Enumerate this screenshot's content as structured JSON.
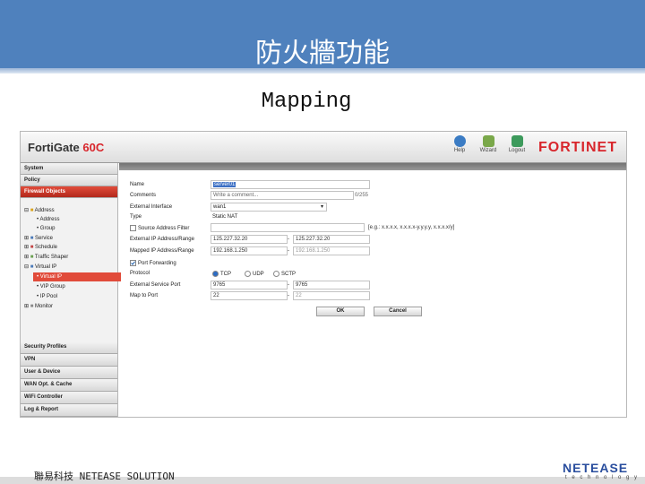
{
  "slide": {
    "title": "防火牆功能",
    "subtitle": "Mapping",
    "footer": "聯易科技  NETEASE SOLUTION",
    "logo": "NETEASE",
    "logo_sub": "t e c h n o l o g y"
  },
  "fortigate": {
    "brand_prefix": "FortiGate",
    "brand_model": "60C",
    "header_buttons": [
      {
        "label": "Help",
        "icon": "help-icon"
      },
      {
        "label": "Wizard",
        "icon": "wizard-icon"
      },
      {
        "label": "Logout",
        "icon": "logout-icon"
      }
    ],
    "logo": "FORTINET",
    "colors": {
      "accent": "#d8262c",
      "nav_active": "#e14b3a"
    }
  },
  "nav": {
    "top_categories": [
      "System",
      "Policy",
      "Firewall Objects"
    ],
    "tree": [
      {
        "label": "Address",
        "indent": 1,
        "icon": "address-icon"
      },
      {
        "label": "Address",
        "indent": 2,
        "icon": "bullet-icon"
      },
      {
        "label": "Group",
        "indent": 2,
        "icon": "bullet-icon"
      },
      {
        "label": "Service",
        "indent": 1,
        "icon": "service-icon"
      },
      {
        "label": "Schedule",
        "indent": 1,
        "icon": "schedule-icon"
      },
      {
        "label": "Traffic Shaper",
        "indent": 1,
        "icon": "shaper-icon"
      },
      {
        "label": "Virtual IP",
        "indent": 1,
        "icon": "vip-icon"
      },
      {
        "label": "Virtual IP",
        "indent": 2,
        "icon": "bullet-icon",
        "selected": true
      },
      {
        "label": "VIP Group",
        "indent": 2,
        "icon": "bullet-icon"
      },
      {
        "label": "IP Pool",
        "indent": 2,
        "icon": "bullet-icon"
      },
      {
        "label": "Monitor",
        "indent": 1,
        "icon": "monitor-icon"
      }
    ],
    "bottom_categories": [
      "Security Profiles",
      "VPN",
      "User & Device",
      "WAN Opt. & Cache",
      "WiFi Controller",
      "Log & Report"
    ]
  },
  "form": {
    "name_label": "Name",
    "name_value": "server01",
    "comments_label": "Comments",
    "comments_placeholder": "Write a comment...",
    "comments_count": "0/255",
    "ext_iface_label": "External Interface",
    "ext_iface_value": "wan1",
    "type_label": "Type",
    "type_value": "Static NAT",
    "src_filter_label": "Source Address Filter",
    "src_filter_hint": "[e.g.: x.x.x.x, x.x.x.x-y.y.y.y, x.x.x.x/y]",
    "ext_ip_label": "External IP Address/Range",
    "ext_ip_from": "125.227.32.20",
    "ext_ip_to": "125.227.32.20",
    "mapped_ip_label": "Mapped IP Address/Range",
    "mapped_ip_from": "192.168.1.250",
    "mapped_ip_to": "192.168.1.250",
    "port_fwd_label": "Port Forwarding",
    "protocol_label": "Protocol",
    "protocols": [
      "TCP",
      "UDP",
      "SCTP"
    ],
    "protocol_selected": "TCP",
    "ext_port_label": "External Service Port",
    "ext_port_from": "9765",
    "ext_port_to": "9765",
    "map_port_label": "Map to Port",
    "map_port_from": "22",
    "map_port_to": "22",
    "dash": "-",
    "ok_label": "OK",
    "cancel_label": "Cancel"
  }
}
